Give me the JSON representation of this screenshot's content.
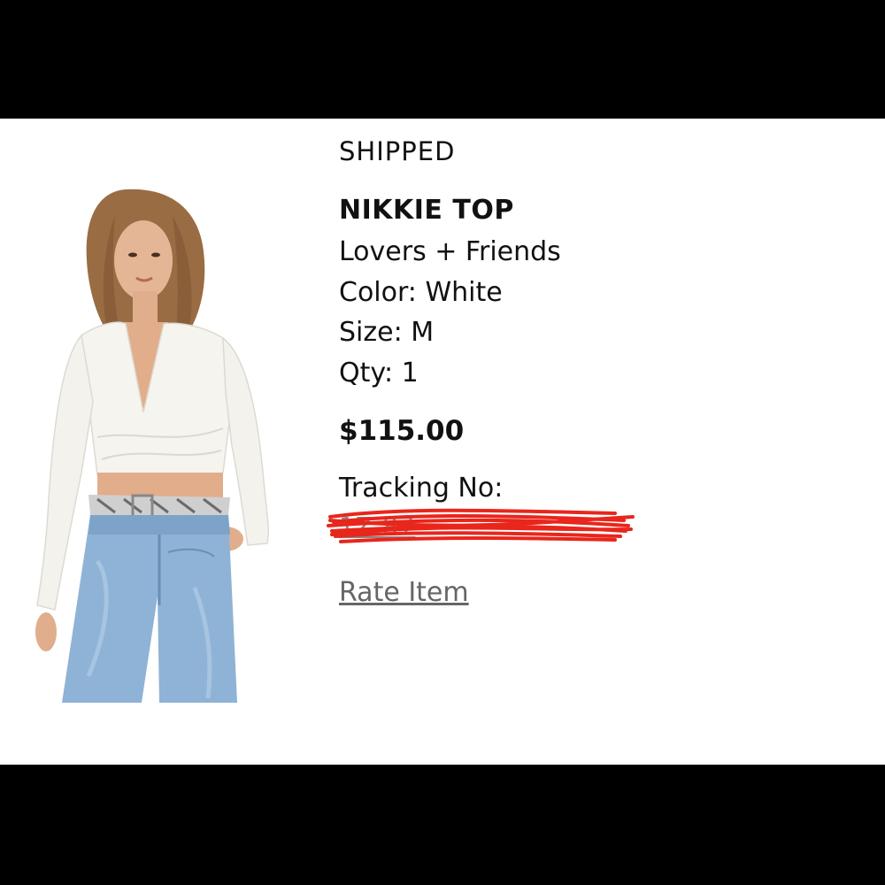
{
  "order_item": {
    "status": "SHIPPED",
    "product_name": "NIKKIE TOP",
    "brand": "Lovers + Friends",
    "color": "Color: White",
    "size": "Size: M",
    "qty": "Qty: 1",
    "price": "$115.00",
    "tracking_label": "Tracking No:",
    "tracking_number_visible": "1Z                    87",
    "rate_item_label": "Rate Item"
  },
  "colors": {
    "background": "#ffffff",
    "letterbox": "#000000",
    "redaction": "#e8261c",
    "link_gray": "#666666"
  }
}
